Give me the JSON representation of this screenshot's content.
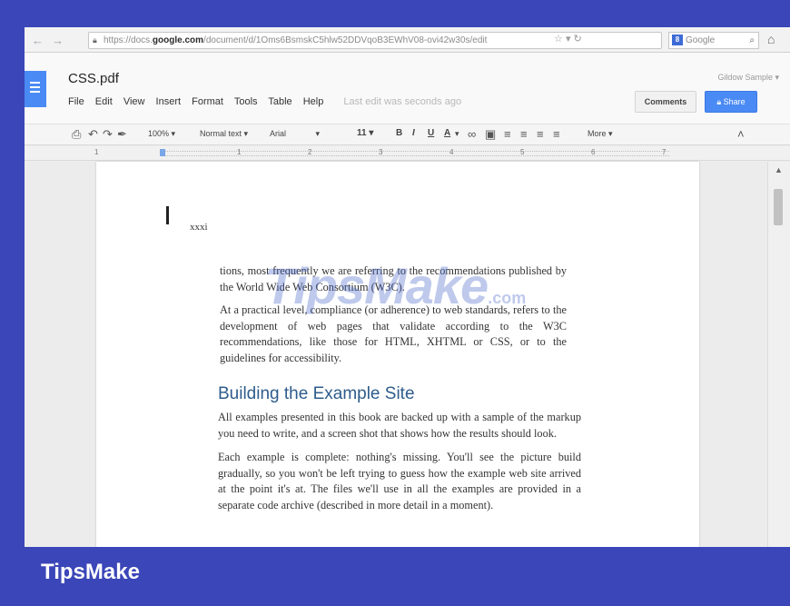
{
  "browser": {
    "url_prefix": "https://docs.",
    "url_host": "google.com",
    "url_path": "/document/d/1Oms6BsmskC5hlw52DDVqoB3EWhV08-ovi42w30s/edit",
    "search_placeholder": "Google"
  },
  "doc": {
    "title": "CSS.pdf",
    "user_name": "Gildow Sample",
    "menu": [
      "File",
      "Edit",
      "View",
      "Insert",
      "Format",
      "Tools",
      "Table",
      "Help"
    ],
    "last_edit": "Last edit was seconds ago",
    "comments_label": "Comments",
    "share_label": "Share"
  },
  "toolbar": {
    "zoom": "100%",
    "style": "Normal text",
    "font": "Arial",
    "size": "11",
    "more": "More"
  },
  "ruler": [
    "1",
    "1",
    "2",
    "3",
    "4",
    "5",
    "6",
    "7"
  ],
  "content": {
    "stray_text": "xxxi",
    "para1": "tions, most frequently we are referring to the recommendations published by the World Wide Web Consortium (W3C).",
    "para2": "At a practical level, compliance (or adherence) to web standards, refers to the development of web pages that validate according to the W3C recommendations, like those for HTML, XHTML or CSS, or to the guidelines for accessibility.",
    "heading": "Building the Example Site",
    "para3": "All examples presented in this book are backed up with a sample of the markup you need to write, and a screen shot that shows how the results should look.",
    "para4": "Each example is complete: nothing's missing. You'll see the picture build gradually, so you won't be left trying to guess how the example web site arrived at the point it's at. The files we'll use in all the examples are provided in a separate code archive (described in more detail in a moment).",
    "watermark": "TipsMake",
    "watermark_suffix": ".com"
  },
  "brand": "TipsMake",
  "icons": [
    "back-arrow-icon",
    "forward-arrow-icon",
    "lock-icon",
    "star-icon",
    "refresh-icon",
    "search-icon",
    "home-icon",
    "docs-logo-icon",
    "print-icon",
    "undo-icon",
    "redo-icon",
    "paint-format-icon",
    "link-icon",
    "comment-icon",
    "align-left-icon",
    "align-center-icon",
    "align-right-icon",
    "justify-icon",
    "collapse-icon"
  ],
  "colors": {
    "frame": "#3b46b8",
    "accent": "#4a8af4",
    "heading": "#2e5c8c"
  }
}
